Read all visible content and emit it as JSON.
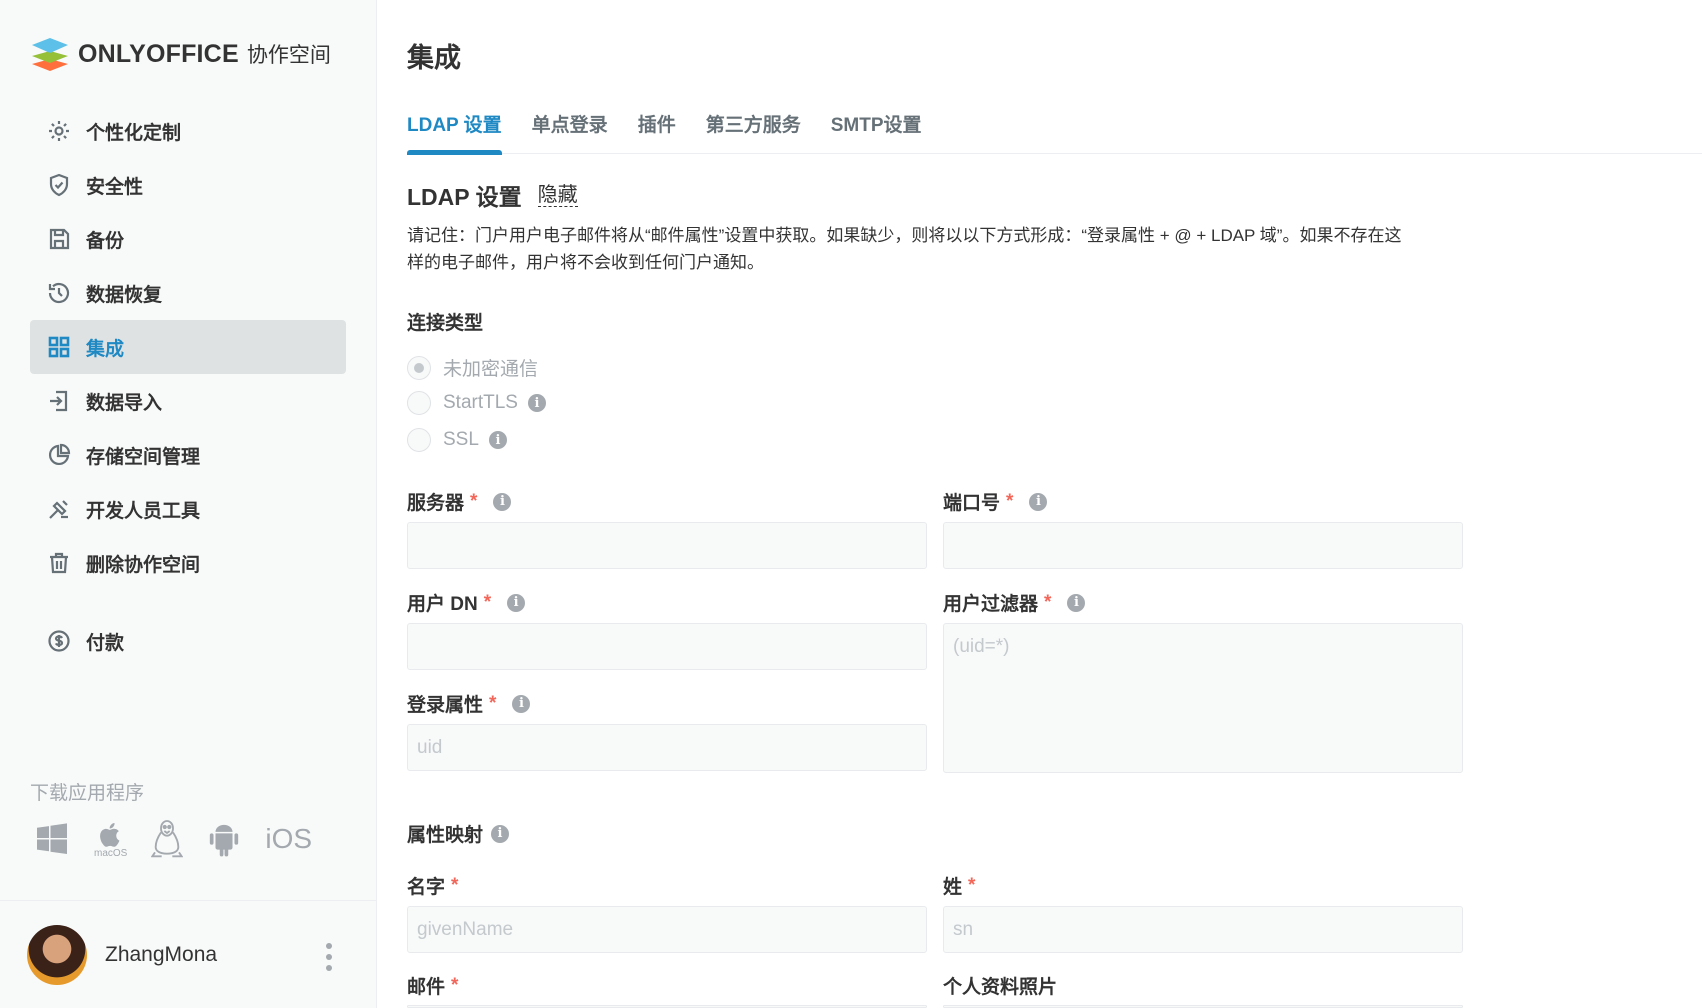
{
  "brand": {
    "name": "ONLYOFFICE",
    "suffix": "协作空间"
  },
  "sidebar": {
    "items": [
      {
        "label": "个性化定制",
        "icon": "gear-icon"
      },
      {
        "label": "安全性",
        "icon": "shield-icon"
      },
      {
        "label": "备份",
        "icon": "save-icon"
      },
      {
        "label": "数据恢复",
        "icon": "restore-icon"
      },
      {
        "label": "集成",
        "icon": "grid-icon",
        "active": true
      },
      {
        "label": "数据导入",
        "icon": "import-icon"
      },
      {
        "label": "存储空间管理",
        "icon": "pie-chart-icon"
      },
      {
        "label": "开发人员工具",
        "icon": "developer-tools-icon"
      },
      {
        "label": "删除协作空间",
        "icon": "trash-icon"
      },
      {
        "label": "付款",
        "icon": "payment-icon"
      }
    ],
    "download_title": "下载应用程序",
    "downloads": {
      "windows": "windows-icon",
      "macos": "macOS",
      "linux": "linux-icon",
      "android": "android-icon",
      "ios": "iOS"
    }
  },
  "profile": {
    "name": "ZhangMona"
  },
  "main": {
    "title": "集成",
    "tabs": [
      "LDAP 设置",
      "单点登录",
      "插件",
      "第三方服务",
      "SMTP设置"
    ],
    "section_title": "LDAP 设置",
    "hide_label": "隐藏",
    "notice_line1": "请记住：门户用户电子邮件将从“邮件属性”设置中获取。如果缺少，则将以以下方式形成：“登录属性 + @ + LDAP 域”。如果不存在这",
    "notice_line2": "样的电子邮件，用户将不会收到任何门户通知。",
    "connection_type_label": "连接类型",
    "connection_options": [
      "未加密通信",
      "StartTLS",
      "SSL"
    ],
    "fields": {
      "server": {
        "label": "服务器",
        "value": ""
      },
      "port": {
        "label": "端口号",
        "value": ""
      },
      "user_dn": {
        "label": "用户 DN",
        "value": ""
      },
      "user_filter": {
        "label": "用户过滤器",
        "placeholder": "(uid=*)"
      },
      "login_attribute": {
        "label": "登录属性",
        "placeholder": "uid"
      }
    },
    "attribute_mapping_label": "属性映射",
    "mapping_fields": {
      "first_name": {
        "label": "名字",
        "placeholder": "givenName"
      },
      "last_name": {
        "label": "姓",
        "placeholder": "sn"
      },
      "email": {
        "label": "邮件"
      },
      "avatar": {
        "label": "个人资料照片"
      }
    },
    "required_mark": "*",
    "info_glyph": "i"
  },
  "colors": {
    "accent": "#1f89c4",
    "required": "#f2675a",
    "muted": "#a3a9ae"
  }
}
